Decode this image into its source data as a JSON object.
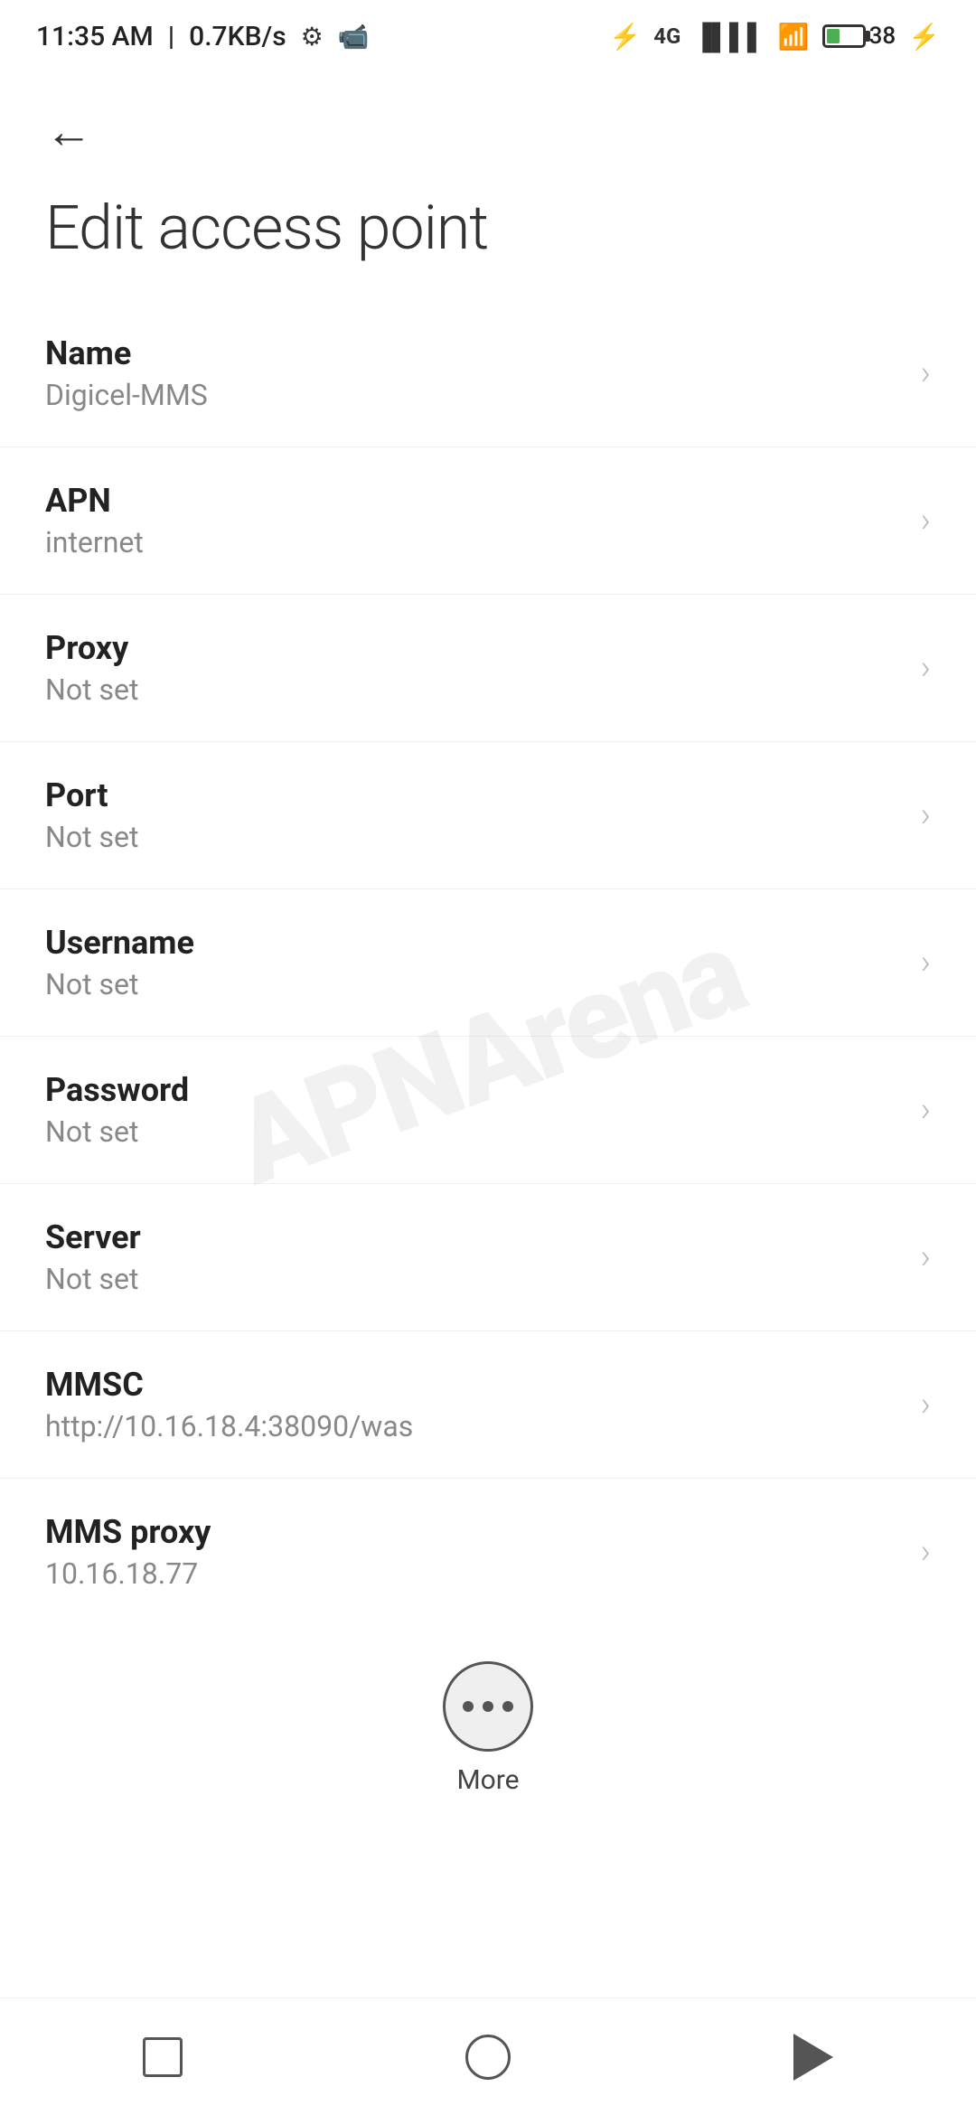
{
  "statusBar": {
    "time": "11:35 AM",
    "speed": "0.7KB/s"
  },
  "page": {
    "title": "Edit access point"
  },
  "settings": [
    {
      "label": "Name",
      "value": "Digicel-MMS"
    },
    {
      "label": "APN",
      "value": "internet"
    },
    {
      "label": "Proxy",
      "value": "Not set"
    },
    {
      "label": "Port",
      "value": "Not set"
    },
    {
      "label": "Username",
      "value": "Not set"
    },
    {
      "label": "Password",
      "value": "Not set"
    },
    {
      "label": "Server",
      "value": "Not set"
    },
    {
      "label": "MMSC",
      "value": "http://10.16.18.4:38090/was"
    },
    {
      "label": "MMS proxy",
      "value": "10.16.18.77"
    }
  ],
  "more": {
    "label": "More"
  },
  "watermark": {
    "text": "APNArena"
  }
}
